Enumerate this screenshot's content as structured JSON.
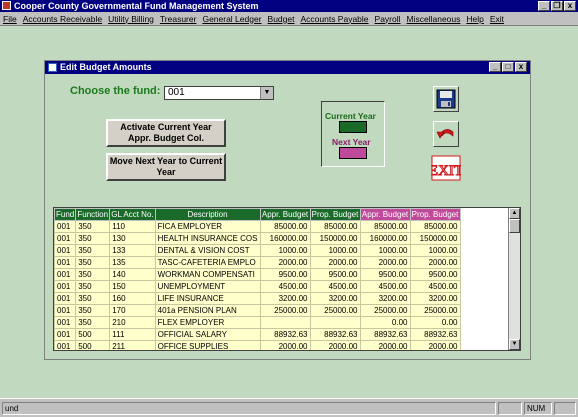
{
  "app": {
    "title": "Cooper County Governmental Fund Management System"
  },
  "menu": [
    "File",
    "Accounts Receivable",
    "Utility Billing",
    "Treasurer",
    "General Ledger",
    "Budget",
    "Accounts Payable",
    "Payroll",
    "Miscellaneous",
    "Help",
    "Exit"
  ],
  "window": {
    "title": "Edit Budget Amounts"
  },
  "form": {
    "fund_label": "Choose the fund:",
    "fund_value": "001",
    "activate_button": "Activate Current Year Appr. Budget Col.",
    "move_button": "Move Next Year to Current Year",
    "legend_current": "Current Year",
    "legend_next": "Next Year",
    "exit_label": "EXIT"
  },
  "colors": {
    "current_year": "#1a6a2a",
    "next_year": "#c04a9a",
    "grid_bg": "#ffffcc"
  },
  "grid": {
    "columns": [
      "Fund",
      "Function",
      "GL Acct No.",
      "Description",
      "Appr. Budget",
      "Prop. Budget",
      "Appr. Budget",
      "Prop. Budget"
    ],
    "rows": [
      [
        "001",
        "350",
        "110",
        "FICA EMPLOYER",
        "85000.00",
        "85000.00",
        "85000.00",
        "85000.00"
      ],
      [
        "001",
        "350",
        "130",
        "HEALTH INSURANCE COS",
        "160000.00",
        "150000.00",
        "160000.00",
        "150000.00"
      ],
      [
        "001",
        "350",
        "133",
        "DENTAL & VISION COST",
        "1000.00",
        "1000.00",
        "1000.00",
        "1000.00"
      ],
      [
        "001",
        "350",
        "135",
        "TASC-CAFETERIA EMPLO",
        "2000.00",
        "2000.00",
        "2000.00",
        "2000.00"
      ],
      [
        "001",
        "350",
        "140",
        "WORKMAN COMPENSATI",
        "9500.00",
        "9500.00",
        "9500.00",
        "9500.00"
      ],
      [
        "001",
        "350",
        "150",
        "UNEMPLOYMENT",
        "4500.00",
        "4500.00",
        "4500.00",
        "4500.00"
      ],
      [
        "001",
        "350",
        "160",
        "LIFE INSURANCE",
        "3200.00",
        "3200.00",
        "3200.00",
        "3200.00"
      ],
      [
        "001",
        "350",
        "170",
        "401a PENSION PLAN",
        "25000.00",
        "25000.00",
        "25000.00",
        "25000.00"
      ],
      [
        "001",
        "350",
        "210",
        "FLEX EMPLOYER",
        "",
        "",
        "0.00",
        "0.00"
      ],
      [
        "001",
        "500",
        "111",
        "OFFICIAL SALARY",
        "88932.63",
        "88932.63",
        "88932.63",
        "88932.63"
      ],
      [
        "001",
        "500",
        "211",
        "OFFICE SUPPLIES",
        "2000.00",
        "2000.00",
        "2000.00",
        "2000.00"
      ]
    ]
  },
  "status": {
    "left": "und",
    "num": "NUM"
  }
}
